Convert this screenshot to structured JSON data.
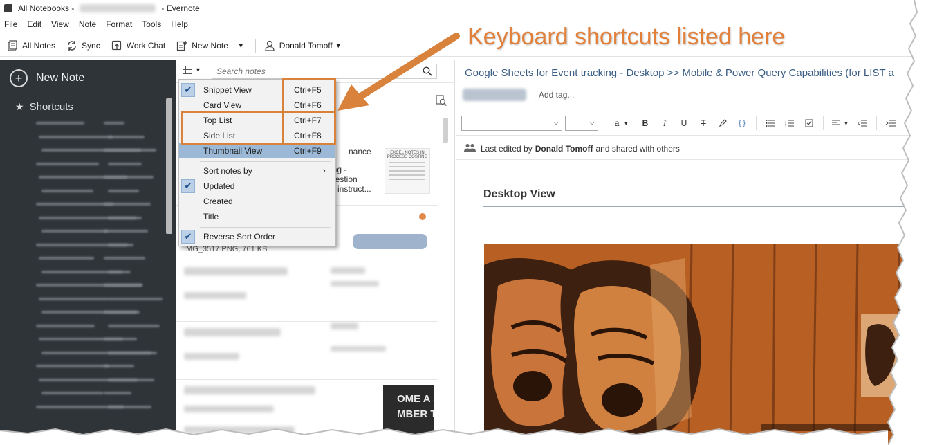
{
  "window": {
    "title_left": "All Notebooks - ",
    "title_right": " - Evernote"
  },
  "menubar": [
    "File",
    "Edit",
    "View",
    "Note",
    "Format",
    "Tools",
    "Help"
  ],
  "toolbar": {
    "all_notes": "All Notes",
    "sync": "Sync",
    "work_chat": "Work Chat",
    "new_note": "New Note",
    "account": "Donald Tomoff"
  },
  "sidebar": {
    "new_note": "New Note",
    "shortcuts": "Shortcuts"
  },
  "notelist": {
    "search_placeholder": "Search notes",
    "snippet_title": "nance",
    "snippet_lines": "ing -\nuestion\ng instruct...",
    "thumb_title": "EXCEL NOTES IN PROCESS COSTING",
    "attachment": "IMG_3517.PNG,  761 KB",
    "dark_thumb": "OME A SEA\nMBER TODA"
  },
  "dropdown": {
    "items": [
      {
        "label": "Snippet View",
        "shortcut": "Ctrl+F5",
        "checked": true
      },
      {
        "label": "Card View",
        "shortcut": "Ctrl+F6",
        "checked": false
      },
      {
        "label": "Top List",
        "shortcut": "Ctrl+F7",
        "checked": false
      },
      {
        "label": "Side List",
        "shortcut": "Ctrl+F8",
        "checked": false
      },
      {
        "label": "Thumbnail View",
        "shortcut": "Ctrl+F9",
        "checked": false
      }
    ],
    "sort_by": "Sort notes by",
    "sort_items": [
      {
        "label": "Updated",
        "checked": true
      },
      {
        "label": "Created",
        "checked": false
      },
      {
        "label": "Title",
        "checked": false
      }
    ],
    "reverse": "Reverse Sort Order"
  },
  "editor": {
    "note_title": "Google Sheets for Event tracking - Desktop >> Mobile & Power Query Capabilities (for LIST a",
    "add_tag": "Add tag...",
    "edited_prefix": "Last edited by",
    "edited_by": "Donald Tomoff",
    "edited_suffix": "and shared with others",
    "heading": "Desktop View"
  },
  "annotation": {
    "text": "Keyboard shortcuts listed here",
    "color": "#e27f38"
  },
  "colors": {
    "sidebar_bg": "#2f3438",
    "menu_highlight": "#9bb8d6",
    "accent_box": "#d9823c",
    "title_link": "#3a5d84"
  }
}
